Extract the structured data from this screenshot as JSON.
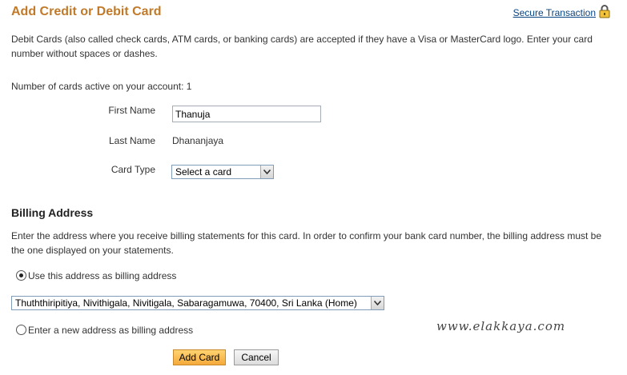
{
  "header": {
    "title": "Add Credit or Debit Card",
    "secure_link": "Secure Transaction",
    "lock_icon": "lock-icon"
  },
  "intro_text": "Debit Cards (also called check cards, ATM cards, or banking cards) are accepted if they have a Visa or MasterCard logo. Enter your card number without spaces or dashes.",
  "active_cards_text": "Number of cards active on your account: 1",
  "form": {
    "first_name_label": "First Name",
    "first_name_value": "Thanuja",
    "last_name_label": "Last Name",
    "last_name_value": "Dhananjaya",
    "card_type_label": "Card Type",
    "card_type_selected": "Select a card"
  },
  "billing": {
    "heading": "Billing Address",
    "description": "Enter the address where you receive billing statements for this card. In order to confirm your bank card number, the billing address must be the one displayed on your statements.",
    "use_address_label": "Use this address as billing address",
    "use_address_checked": true,
    "address_selected": "Thuththiripitiya, Nivithigala, Nivitigala, Sabaragamuwa, 70400, Sri Lanka (Home)",
    "new_address_label": "Enter a new address as billing address",
    "new_address_checked": false
  },
  "buttons": {
    "add": "Add Card",
    "cancel": "Cancel"
  },
  "watermark": "www.elakkaya.com",
  "colors": {
    "title": "#c07a2a",
    "link": "#084482",
    "primary_button": "#f4a93a"
  }
}
